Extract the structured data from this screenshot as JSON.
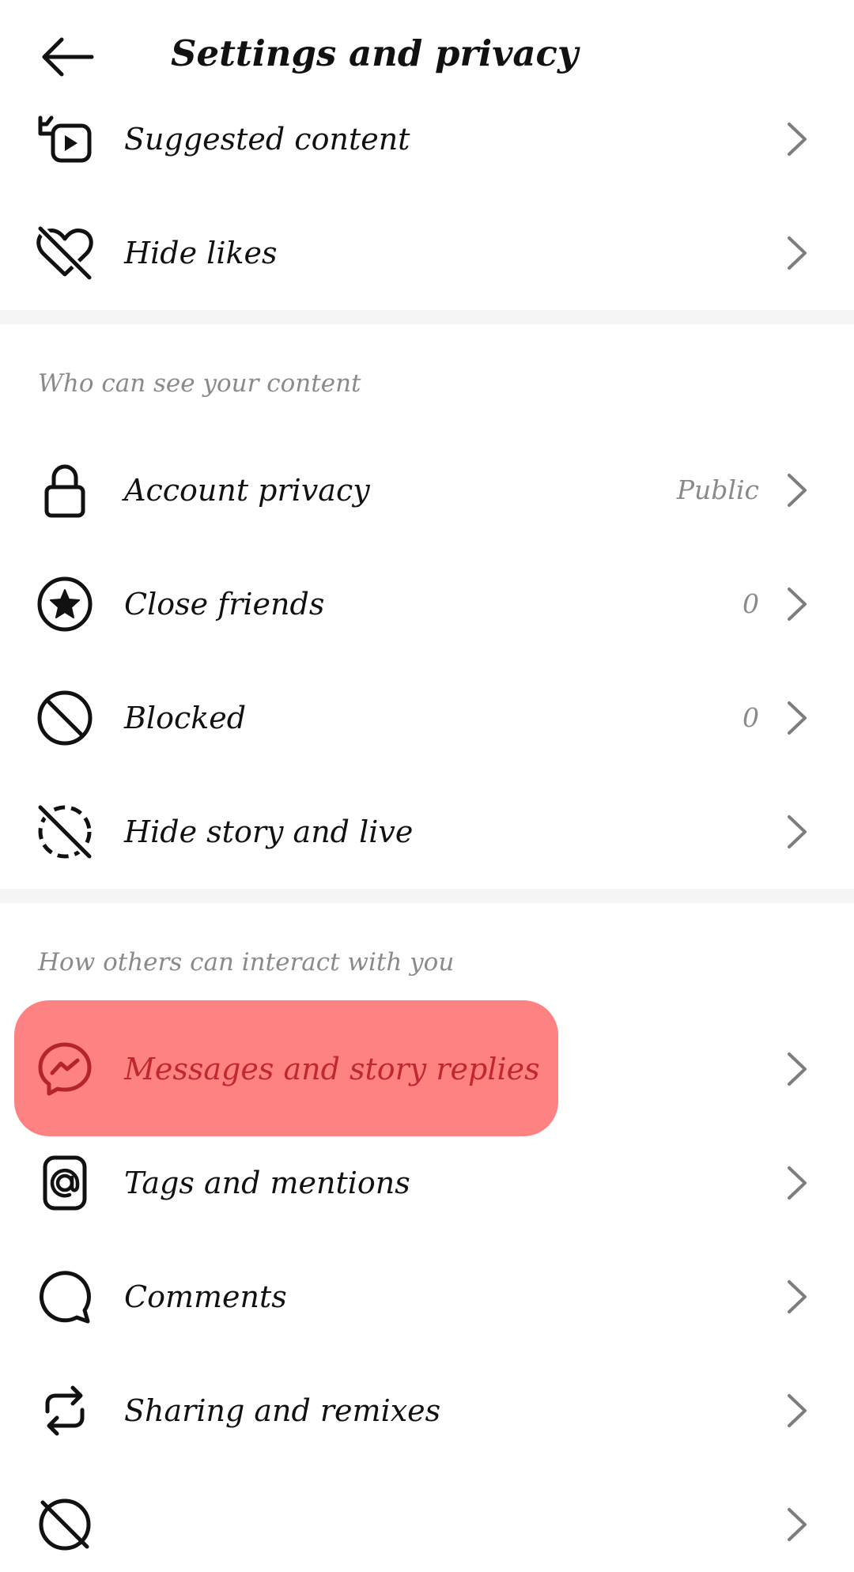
{
  "header": {
    "title": "Settings and privacy",
    "back_icon": "arrow-left-icon"
  },
  "rows_top": [
    {
      "icon": "suggested-content-icon",
      "label": "Suggested content"
    },
    {
      "icon": "hide-likes-icon",
      "label": "Hide likes"
    }
  ],
  "sections": [
    {
      "title": "Who can see your content",
      "items": [
        {
          "icon": "lock-icon",
          "label": "Account privacy",
          "value": "Public"
        },
        {
          "icon": "close-friends-star-icon",
          "label": "Close friends",
          "value": "0"
        },
        {
          "icon": "blocked-icon",
          "label": "Blocked",
          "value": "0"
        },
        {
          "icon": "hide-story-icon",
          "label": "Hide story and live",
          "value": ""
        }
      ]
    },
    {
      "title": "How others can interact with you",
      "items": [
        {
          "icon": "messenger-icon",
          "label": "Messages and story replies",
          "value": ""
        },
        {
          "icon": "at-sign-icon",
          "label": "Tags and mentions",
          "value": ""
        },
        {
          "icon": "comment-icon",
          "label": "Comments",
          "value": ""
        },
        {
          "icon": "share-remix-icon",
          "label": "Sharing and remixes",
          "value": ""
        }
      ]
    }
  ],
  "colors": {
    "highlight": "#ff8282",
    "highlight_text": "#c0282d",
    "secondary_text": "#8a8a8a",
    "divider": "#f5f5f5"
  }
}
